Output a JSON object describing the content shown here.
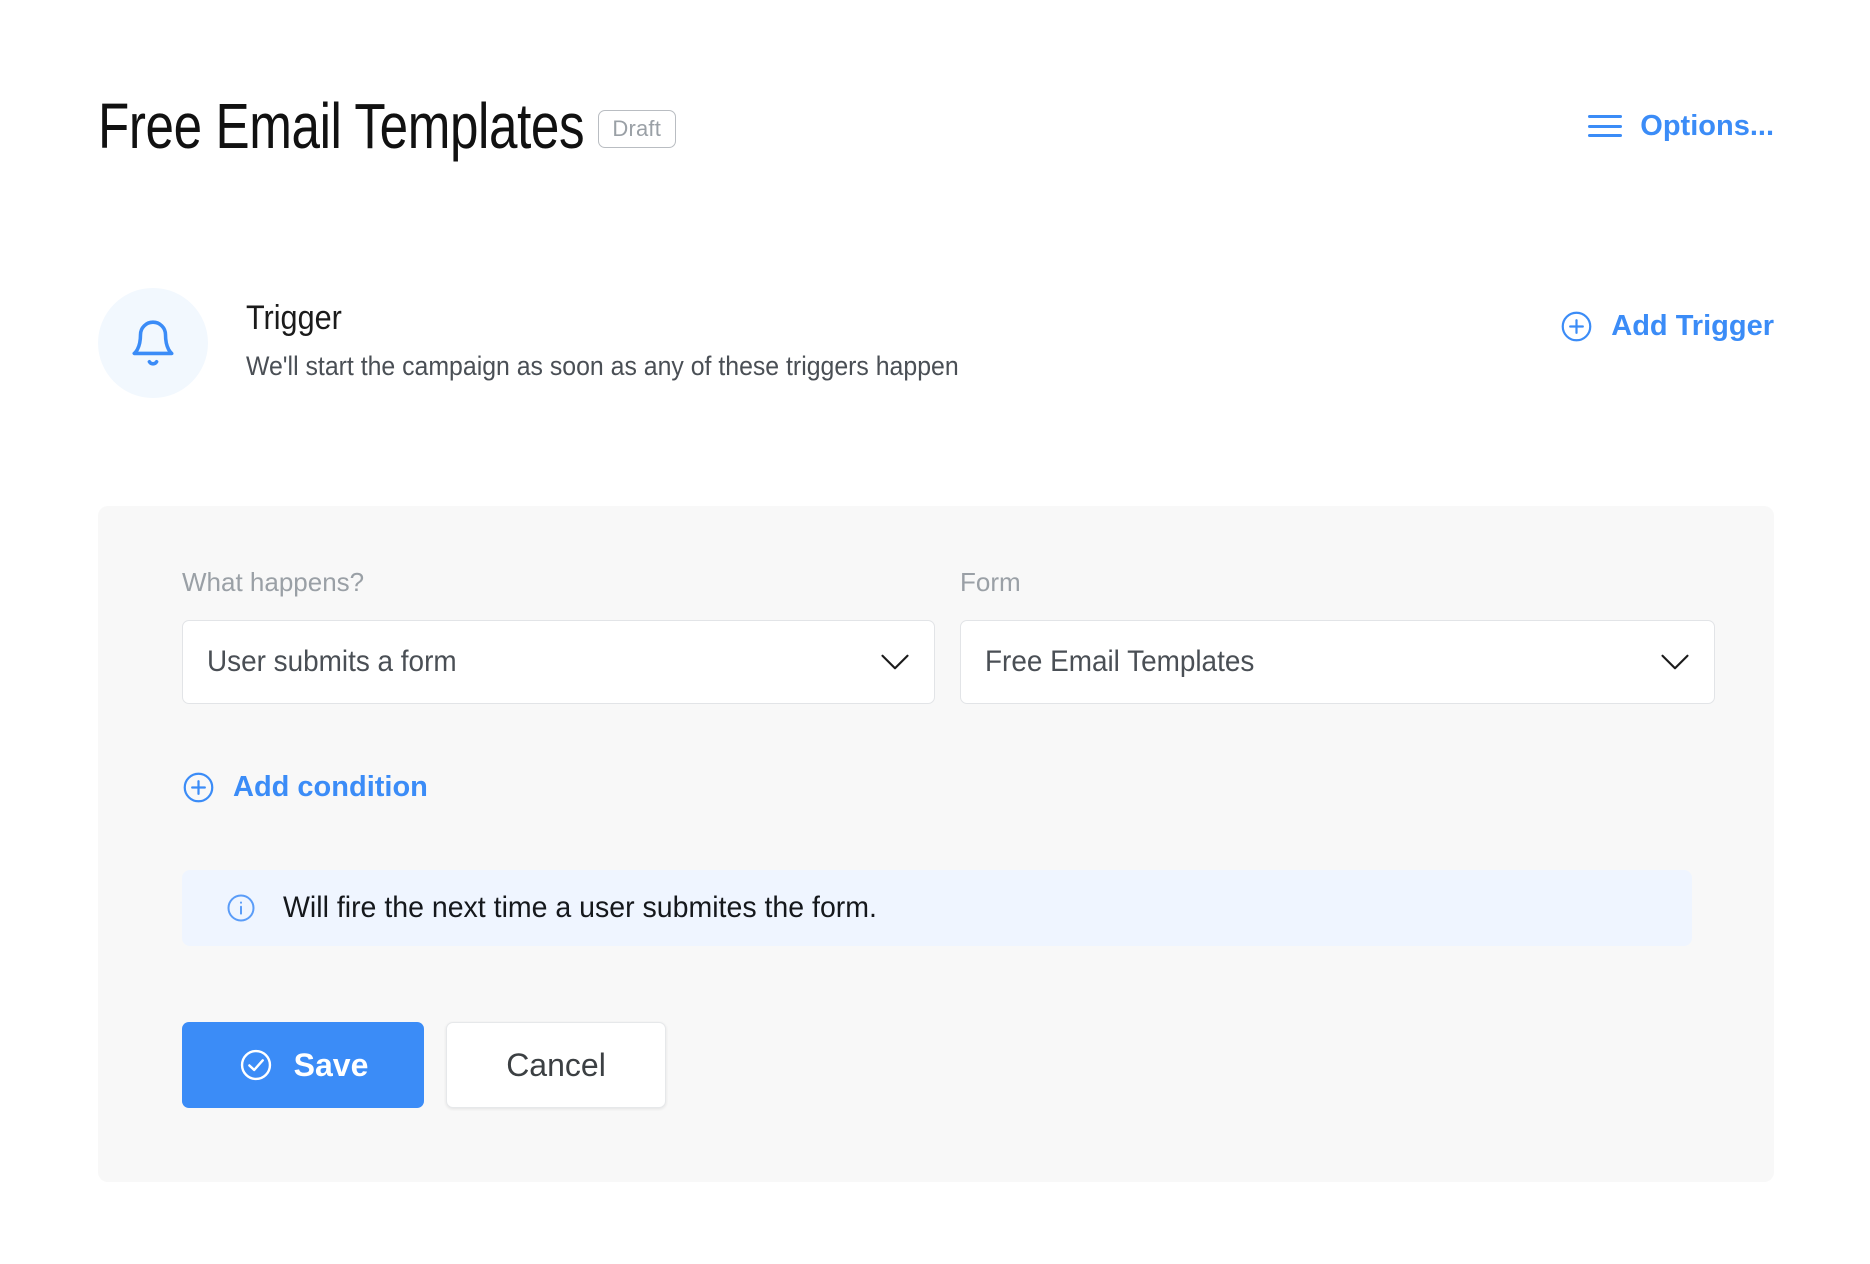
{
  "header": {
    "title": "Free Email Templates",
    "status_badge": "Draft",
    "options_label": "Options...",
    "menu_icon": "hamburger-icon"
  },
  "trigger": {
    "icon": "bell-icon",
    "title": "Trigger",
    "subtitle": "We'll start the campaign as soon as any of these triggers happen",
    "add_trigger_label": "Add Trigger",
    "add_trigger_icon": "plus-circle-icon"
  },
  "panel": {
    "fields": [
      {
        "label": "What happens?",
        "value": "User submits a form",
        "icon": "chevron-down-icon"
      },
      {
        "label": "Form",
        "value": "Free Email Templates",
        "icon": "chevron-down-icon"
      }
    ],
    "add_condition_label": "Add condition",
    "add_condition_icon": "plus-circle-icon",
    "info": {
      "icon": "info-circle-icon",
      "text": "Will fire the next time a user submites the form."
    },
    "buttons": {
      "save_label": "Save",
      "save_icon": "check-circle-icon",
      "cancel_label": "Cancel"
    }
  },
  "colors": {
    "accent": "#3b8cf7",
    "panel_bg": "#f8f8f8",
    "info_bg": "#eff5ff",
    "avatar_bg": "#f2f8fe",
    "muted_text": "#9aa0a6"
  }
}
